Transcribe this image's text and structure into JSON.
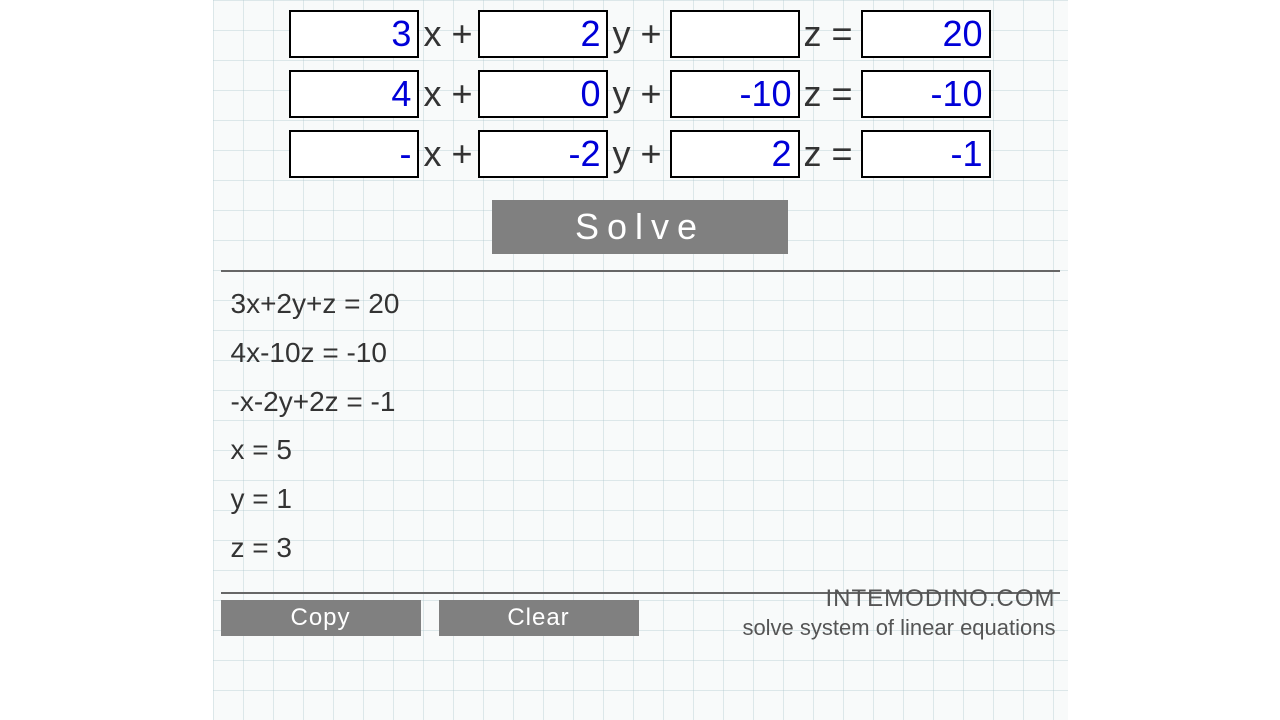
{
  "labels": {
    "x_plus": "x +",
    "y_plus": "y +",
    "z_eq": "z =",
    "solve": "Solve",
    "copy": "Copy",
    "clear": "Clear"
  },
  "rows": [
    {
      "a": "3",
      "b": "2",
      "c": "",
      "d": "20"
    },
    {
      "a": "4",
      "b": "0",
      "c": "-10",
      "d": "-10"
    },
    {
      "a": "-",
      "b": "-2",
      "c": "2",
      "d": "-1"
    }
  ],
  "results": [
    "3x+2y+z = 20",
    "4x-10z = -10",
    "-x-2y+2z = -1",
    "x = 5",
    "y = 1",
    "z = 3"
  ],
  "brand": {
    "site": "INTEMODINO.COM",
    "tagline": "solve system of linear equations"
  }
}
